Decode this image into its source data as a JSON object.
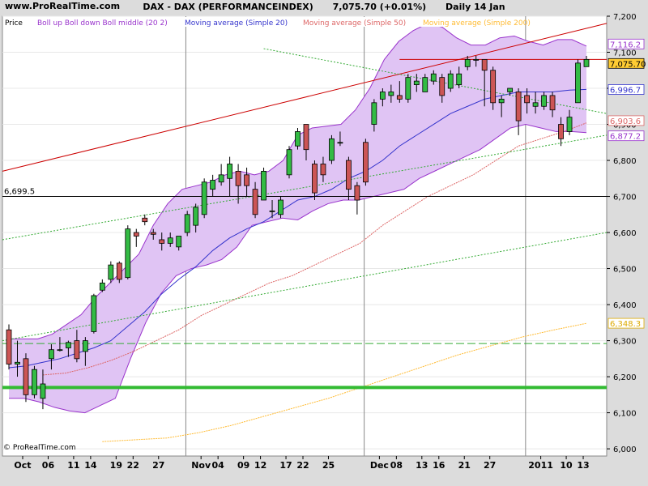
{
  "site": "www.ProRealTime.com",
  "header": {
    "title": "DAX - DAX (PERFORMANCEINDEX)",
    "price": "7,075.70 (+0.01%)",
    "period": "Daily  14 Jan"
  },
  "legend": {
    "price": "Price",
    "boll": "Boll up Boll down Boll middle (20 2)",
    "ma20": "Moving average (Simple 20)",
    "ma50": "Moving average (Simple 50)",
    "ma200": "Moving average (Simple 200)"
  },
  "copyright": "© ProRealTime.com",
  "colors": {
    "up": "#33bb44",
    "down": "#cc5555",
    "boll_fill": "#e0c4f4",
    "boll_line": "#9933cc",
    "ma20": "#3333cc",
    "ma50": "#dd6666",
    "ma200": "#ffbb33",
    "trend_red": "#cc0000",
    "support_green": "#33bb33"
  },
  "chart_data": {
    "type": "candlestick",
    "ylim": [
      5980,
      7200
    ],
    "y_ticks": [
      "7,200",
      "7,100",
      "7,000",
      "6,900",
      "6,800",
      "6,700",
      "6,600",
      "6,500",
      "6,400",
      "6,300",
      "6,200",
      "6,100",
      "6,000"
    ],
    "x_ticks": [
      "Oct",
      "06",
      "11",
      "14",
      "19",
      "22",
      "27",
      "Nov",
      "04",
      "09",
      "12",
      "17",
      "22",
      "25",
      "Dec",
      "08",
      "13",
      "16",
      "21",
      "27",
      "2011",
      "10",
      "13"
    ],
    "value_labels": [
      {
        "text": "7,116.2",
        "color": "#9933cc"
      },
      {
        "text": "7,075.70",
        "color": "#000000",
        "bg": "#ffcc33"
      },
      {
        "text": "6,996.7",
        "color": "#3333cc"
      },
      {
        "text": "6,903.6",
        "color": "#dd6666"
      },
      {
        "text": "6,877.2",
        "color": "#9933cc"
      },
      {
        "text": "6,348.3",
        "color": "#ddaa00"
      }
    ],
    "horizontal_line_label": "6,699.5",
    "candles": [
      [
        6330,
        6345,
        6220,
        6235
      ],
      [
        6235,
        6300,
        6200,
        6240
      ],
      [
        6250,
        6265,
        6130,
        6150
      ],
      [
        6150,
        6230,
        6140,
        6220
      ],
      [
        6140,
        6220,
        6110,
        6180
      ],
      [
        6250,
        6290,
        6220,
        6275
      ],
      [
        6275,
        6310,
        6270,
        6275
      ],
      [
        6280,
        6300,
        6255,
        6295
      ],
      [
        6300,
        6330,
        6240,
        6250
      ],
      [
        6270,
        6310,
        6230,
        6300
      ],
      [
        6325,
        6430,
        6320,
        6425
      ],
      [
        6440,
        6470,
        6435,
        6460
      ],
      [
        6470,
        6520,
        6460,
        6510
      ],
      [
        6515,
        6520,
        6460,
        6470
      ],
      [
        6475,
        6620,
        6470,
        6610
      ],
      [
        6600,
        6610,
        6560,
        6590
      ],
      [
        6640,
        6650,
        6620,
        6630
      ],
      [
        6600,
        6610,
        6580,
        6595
      ],
      [
        6580,
        6600,
        6550,
        6570
      ],
      [
        6570,
        6600,
        6560,
        6585
      ],
      [
        6560,
        6590,
        6550,
        6590
      ],
      [
        6600,
        6660,
        6590,
        6650
      ],
      [
        6620,
        6680,
        6600,
        6670
      ],
      [
        6650,
        6750,
        6640,
        6740
      ],
      [
        6720,
        6760,
        6700,
        6745
      ],
      [
        6740,
        6790,
        6730,
        6760
      ],
      [
        6750,
        6810,
        6700,
        6790
      ],
      [
        6770,
        6790,
        6680,
        6730
      ],
      [
        6760,
        6780,
        6700,
        6730
      ],
      [
        6720,
        6740,
        6640,
        6650
      ],
      [
        6690,
        6780,
        6690,
        6770
      ],
      [
        6660,
        6690,
        6640,
        6660
      ],
      [
        6650,
        6700,
        6640,
        6690
      ],
      [
        6760,
        6840,
        6750,
        6830
      ],
      [
        6840,
        6890,
        6830,
        6880
      ],
      [
        6900,
        6900,
        6800,
        6830
      ],
      [
        6790,
        6800,
        6690,
        6710
      ],
      [
        6790,
        6810,
        6740,
        6760
      ],
      [
        6800,
        6870,
        6790,
        6860
      ],
      [
        6850,
        6880,
        6840,
        6850
      ],
      [
        6800,
        6810,
        6690,
        6720
      ],
      [
        6730,
        6740,
        6650,
        6690
      ],
      [
        6850,
        6860,
        6730,
        6740
      ],
      [
        6900,
        6970,
        6880,
        6960
      ],
      [
        6970,
        7000,
        6950,
        6990
      ],
      [
        6980,
        7010,
        6960,
        6990
      ],
      [
        6980,
        7020,
        6960,
        6970
      ],
      [
        6970,
        7040,
        6960,
        7030
      ],
      [
        7010,
        7040,
        6990,
        7020
      ],
      [
        6990,
        7040,
        6990,
        7030
      ],
      [
        7020,
        7050,
        7010,
        7040
      ],
      [
        7030,
        7040,
        6960,
        6980
      ],
      [
        7000,
        7050,
        6990,
        7040
      ],
      [
        7010,
        7060,
        7000,
        7040
      ],
      [
        7060,
        7090,
        7050,
        7080
      ],
      [
        7080,
        7090,
        7060,
        7080
      ],
      [
        7080,
        7080,
        6950,
        7050
      ],
      [
        7050,
        7060,
        6940,
        6960
      ],
      [
        6960,
        6980,
        6920,
        6970
      ],
      [
        6990,
        7000,
        6980,
        7000
      ],
      [
        6990,
        7000,
        6870,
        6910
      ],
      [
        6980,
        7000,
        6930,
        6960
      ],
      [
        6950,
        6990,
        6930,
        6960
      ],
      [
        6950,
        6990,
        6940,
        6980
      ],
      [
        6980,
        6990,
        6920,
        6940
      ],
      [
        6900,
        6920,
        6840,
        6860
      ],
      [
        6880,
        6940,
        6870,
        6920
      ],
      [
        6960,
        7080,
        6960,
        7070
      ],
      [
        7060,
        7090,
        7060,
        7080
      ]
    ],
    "series": [
      {
        "name": "Boll up",
        "values": [
          6305,
          6305,
          6305,
          6318,
          6345,
          6372,
          6420,
          6460,
          6500,
          6540,
          6620,
          6680,
          6720,
          6730,
          6740,
          6760,
          6770,
          6760,
          6770,
          6800,
          6870,
          6890,
          6895,
          6900,
          6940,
          7000,
          7080,
          7130,
          7160,
          7180,
          7170,
          7140,
          7120,
          7120,
          7140,
          7145,
          7130,
          7120,
          7135,
          7135,
          7117
        ]
      },
      {
        "name": "Boll down",
        "values": [
          6140,
          6140,
          6130,
          6115,
          6105,
          6100,
          6120,
          6140,
          6250,
          6350,
          6430,
          6480,
          6500,
          6510,
          6525,
          6560,
          6620,
          6630,
          6640,
          6635,
          6660,
          6680,
          6690,
          6690,
          6700,
          6710,
          6720,
          6750,
          6770,
          6790,
          6810,
          6830,
          6860,
          6890,
          6900,
          6890,
          6880,
          6880,
          6877
        ]
      },
      {
        "name": "Boll middle",
        "values": [
          6225,
          6230,
          6240,
          6250,
          6265,
          6280,
          6300,
          6340,
          6380,
          6430,
          6470,
          6505,
          6550,
          6585,
          6610,
          6630,
          6660,
          6690,
          6700,
          6720,
          6750,
          6770,
          6800,
          6840,
          6870,
          6900,
          6930,
          6950,
          6970,
          6980,
          6990,
          6990,
          6990,
          6995,
          6997
        ]
      },
      {
        "name": "Moving average (Simple 50)",
        "values": [
          6205,
          6210,
          6225,
          6245,
          6270,
          6300,
          6330,
          6370,
          6400,
          6430,
          6460,
          6480,
          6510,
          6540,
          6570,
          6620,
          6660,
          6700,
          6730,
          6760,
          6800,
          6840,
          6860,
          6880,
          6904
        ]
      },
      {
        "name": "Moving average (Simple 200)",
        "values": [
          6020,
          6025,
          6030,
          6045,
          6065,
          6090,
          6115,
          6140,
          6170,
          6200,
          6230,
          6260,
          6285,
          6310,
          6330,
          6348
        ]
      }
    ]
  }
}
